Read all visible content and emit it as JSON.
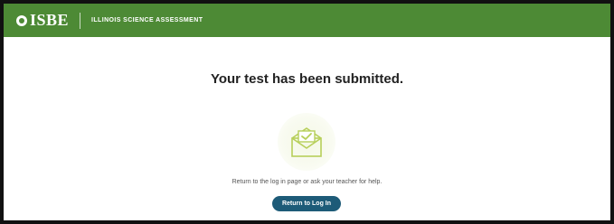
{
  "header": {
    "logo_text": "ISBE",
    "subtitle": "ILLINOIS SCIENCE ASSESSMENT",
    "brand_color": "#4d8a35"
  },
  "main": {
    "title": "Your test has been submitted.",
    "icon": "envelope-check-icon",
    "message": "Return to the log in page or ask your teacher for help.",
    "button_label": "Return to Log In",
    "button_color": "#1d5b78"
  }
}
